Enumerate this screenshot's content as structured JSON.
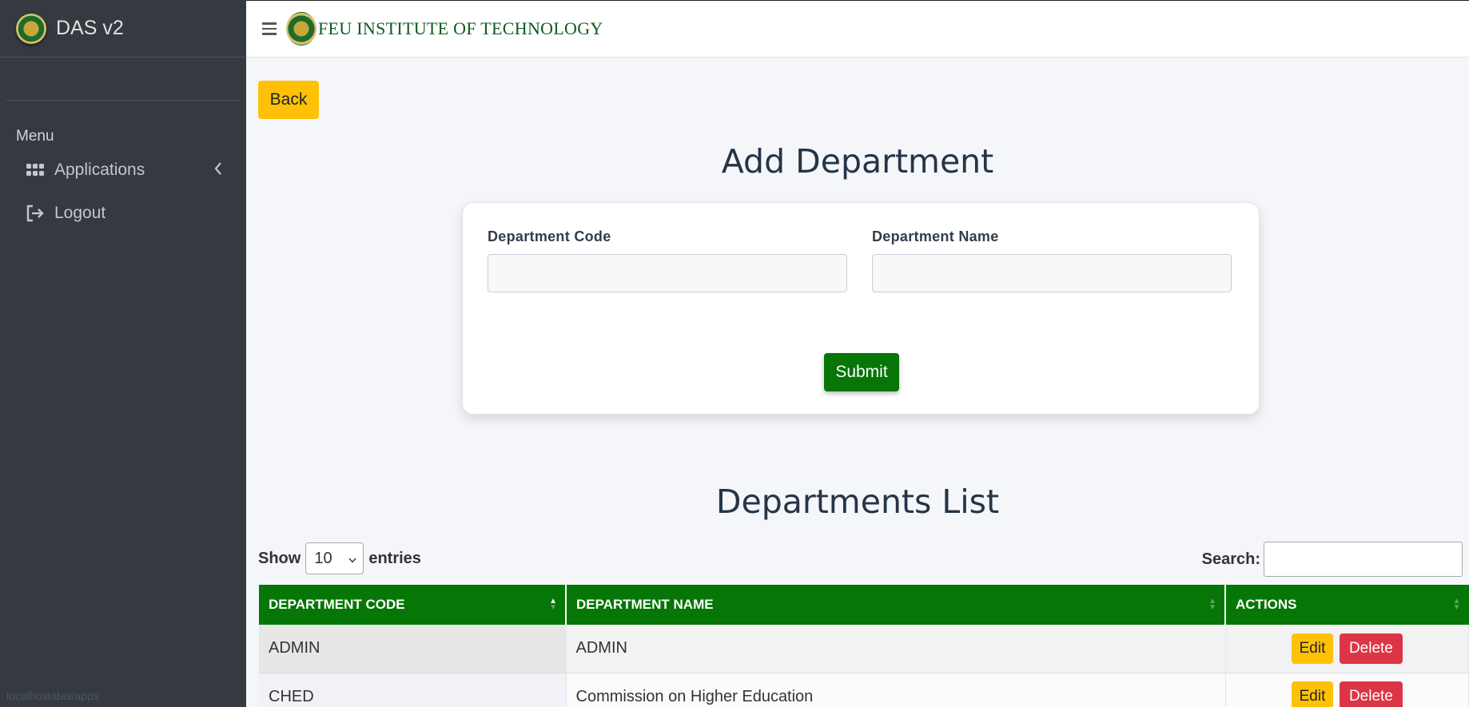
{
  "brand": {
    "title": "DAS v2"
  },
  "sidebar": {
    "menu_header": "Menu",
    "items": [
      {
        "label": "Applications",
        "icon": "apps-grid-icon",
        "has_submenu": true
      },
      {
        "label": "Logout",
        "icon": "logout-icon"
      }
    ]
  },
  "status_bar": {
    "url": "localhost/das/apps"
  },
  "topbar": {
    "institution": "FEU INSTITUTE OF TECHNOLOGY"
  },
  "content": {
    "back_label": "Back",
    "add_title": "Add Department",
    "form": {
      "code_label": "Department Code",
      "code_value": "",
      "name_label": "Department Name",
      "name_value": "",
      "submit_label": "Submit"
    },
    "list_title": "Departments List",
    "table_controls": {
      "show_label": "Show",
      "entries_value": "10",
      "entries_label": "entries",
      "search_label": "Search:",
      "search_value": ""
    },
    "table": {
      "columns": [
        "DEPARTMENT CODE",
        "DEPARTMENT NAME",
        "ACTIONS"
      ],
      "rows": [
        {
          "code": "ADMIN",
          "name": "ADMIN",
          "edit": "Edit",
          "delete": "Delete"
        },
        {
          "code": "CHED",
          "name": "Commission on Higher Education",
          "edit": "Edit",
          "delete": "Delete"
        }
      ]
    }
  },
  "colors": {
    "sidebar_bg": "#343a40",
    "accent_green": "#067606",
    "warning": "#ffc107",
    "danger": "#dc3545"
  }
}
